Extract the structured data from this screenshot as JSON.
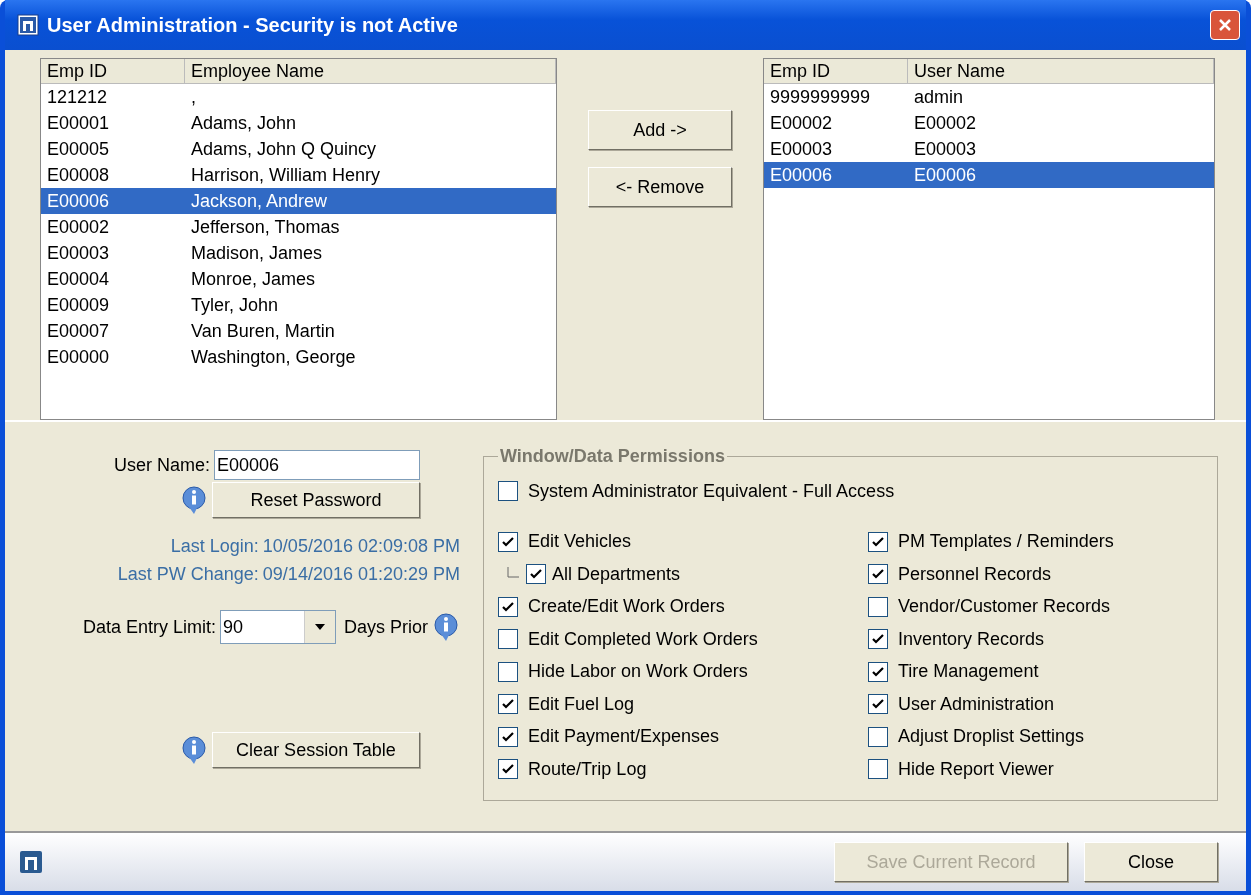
{
  "window": {
    "title": "User Administration - Security is not Active"
  },
  "employees": {
    "columns": [
      "Emp ID",
      "Employee Name"
    ],
    "rows": [
      {
        "id": "121212",
        "name": ",",
        "selected": false
      },
      {
        "id": "E00001",
        "name": "Adams, John",
        "selected": false
      },
      {
        "id": "E00005",
        "name": "Adams, John Q Quincy",
        "selected": false
      },
      {
        "id": "E00008",
        "name": "Harrison, William Henry",
        "selected": false
      },
      {
        "id": "E00006",
        "name": "Jackson, Andrew",
        "selected": true
      },
      {
        "id": "E00002",
        "name": "Jefferson, Thomas",
        "selected": false
      },
      {
        "id": "E00003",
        "name": "Madison, James",
        "selected": false
      },
      {
        "id": "E00004",
        "name": "Monroe, James",
        "selected": false
      },
      {
        "id": "E00009",
        "name": "Tyler, John",
        "selected": false
      },
      {
        "id": "E00007",
        "name": "Van Buren, Martin",
        "selected": false
      },
      {
        "id": "E00000",
        "name": "Washington, George",
        "selected": false
      }
    ]
  },
  "transfer_buttons": [
    "Add ->",
    "<- Remove"
  ],
  "users": {
    "columns": [
      "Emp ID",
      "User Name"
    ],
    "rows": [
      {
        "id": "9999999999",
        "name": "admin",
        "selected": false
      },
      {
        "id": "E00002",
        "name": "E00002",
        "selected": false
      },
      {
        "id": "E00003",
        "name": "E00003",
        "selected": false
      },
      {
        "id": "E00006",
        "name": "E00006",
        "selected": true
      }
    ]
  },
  "details": {
    "user_name_label": "User Name:",
    "user_name": "E00006",
    "reset_button": "Reset Password",
    "last_login_label": "Last Login:",
    "last_login": "10/05/2016 02:09:08 PM",
    "last_pw_label": "Last PW Change:",
    "last_pw": "09/14/2016 01:20:29 PM",
    "limit_label": "Data Entry Limit:",
    "limit_value": "90",
    "limit_suffix": "Days Prior",
    "clear_button": "Clear Session Table"
  },
  "permissions": {
    "title": "Window/Data Permissions",
    "full_access": {
      "label": "System Administrator Equivalent - Full Access",
      "checked": false
    },
    "left": [
      {
        "label": "Edit Vehicles",
        "checked": true,
        "children": [
          {
            "label": "All Departments",
            "checked": true
          }
        ]
      },
      {
        "label": "Create/Edit Work Orders",
        "checked": true
      },
      {
        "label": "Edit Completed Work Orders",
        "checked": false
      },
      {
        "label": "Hide Labor on Work Orders",
        "checked": false
      },
      {
        "label": "Edit Fuel Log",
        "checked": true
      },
      {
        "label": "Edit Payment/Expenses",
        "checked": true
      },
      {
        "label": "Route/Trip Log",
        "checked": true
      }
    ],
    "right": [
      {
        "label": "PM Templates / Reminders",
        "checked": true
      },
      {
        "label": "Personnel Records",
        "checked": true
      },
      {
        "label": "Vendor/Customer Records",
        "checked": false
      },
      {
        "label": "Inventory Records",
        "checked": true
      },
      {
        "label": "Tire Management",
        "checked": true
      },
      {
        "label": "User Administration",
        "checked": true
      },
      {
        "label": "Adjust Droplist Settings",
        "checked": false
      },
      {
        "label": "Hide Report Viewer",
        "checked": false
      }
    ]
  },
  "footer_buttons": [
    {
      "label": "Save Current Record",
      "disabled": true
    },
    {
      "label": "Close",
      "disabled": false
    }
  ]
}
